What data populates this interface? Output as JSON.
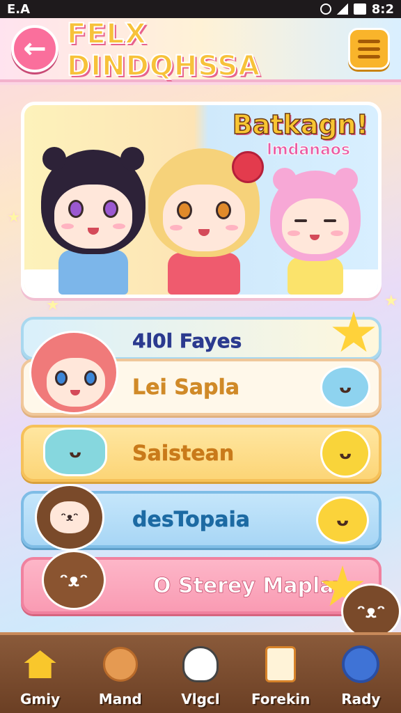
{
  "status_bar": {
    "left_text": "E.A",
    "time": "8:2"
  },
  "header": {
    "title": "FELX DINDQHSSA",
    "back_symbol": "←"
  },
  "hero": {
    "title": "Batkagn!",
    "subtitle": "lmdanaos"
  },
  "menu": {
    "items": [
      {
        "label": "4l0l Fayes"
      },
      {
        "label": "Lei Sapla"
      },
      {
        "label": "Saistean"
      },
      {
        "label": "desTopaia"
      },
      {
        "label": "O Sterey Maplay"
      }
    ]
  },
  "bottom_nav": {
    "items": [
      {
        "label": "Gmiy",
        "icon": "home-icon"
      },
      {
        "label": "Mand",
        "icon": "teddy-bear-icon"
      },
      {
        "label": "Vlgcl",
        "icon": "ghost-icon"
      },
      {
        "label": "Forekin",
        "icon": "document-icon"
      },
      {
        "label": "Rady",
        "icon": "search-icon"
      }
    ]
  },
  "colors": {
    "accent_pink": "#fa6f9c",
    "accent_yellow": "#f9b42b",
    "nav_brown": "#6b3f24"
  }
}
